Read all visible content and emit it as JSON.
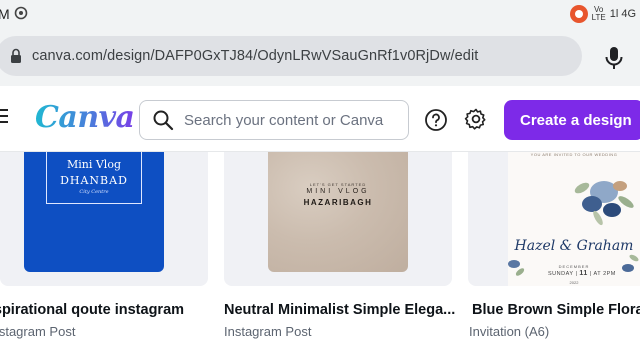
{
  "statusbar": {
    "time_fragment": "M",
    "network_label": "Vo\nLTE",
    "signal_text": "1l 4G"
  },
  "browser": {
    "url": "canva.com/design/DAFP0GxTJ84/OdynLRwVSauGnRf1v0RjDw/edit"
  },
  "header": {
    "logo": "Canva",
    "search_placeholder": "Search your content or Canva",
    "create_button": "Create a design"
  },
  "cards": [
    {
      "title": "Inspirational qoute instagram",
      "subtitle": "Instagram Post",
      "thumb_line1": "Mini Vlog",
      "thumb_line2": "DHANBAD",
      "thumb_line3": "City Centre"
    },
    {
      "title": "Neutral Minimalist Simple Elega...",
      "subtitle": "Instagram Post",
      "thumb_line1": "LET'S GET STARTED",
      "thumb_line2": "MINI VLOG",
      "thumb_line3": "HAZARIBAGH"
    },
    {
      "title": "Blue Brown Simple Floral",
      "subtitle": "Invitation (A6)",
      "thumb_line1": "YOU ARE INVITED TO OUR WEDDING",
      "thumb_names": "Hazel & Graham",
      "thumb_month": "DECEMBER",
      "thumb_day_left": "SUNDAY",
      "thumb_day": "11",
      "thumb_time": "AT 2PM",
      "thumb_year": "2022"
    }
  ],
  "colors": {
    "accent_purple": "#7d2ae8",
    "blue_card": "#0e4fc2",
    "beige_card": "#cbbcae"
  }
}
